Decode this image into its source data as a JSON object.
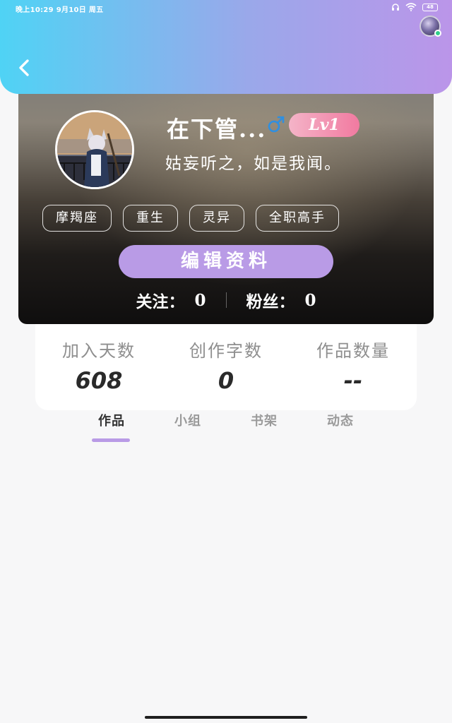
{
  "status_bar": {
    "time": "晚上10:29  9月10日  周五",
    "battery": "48"
  },
  "profile": {
    "username": "在下管...",
    "gender_symbol": "♂",
    "level": "Lv1",
    "bio": "姑妄听之，如是我闻。",
    "tags": [
      "摩羯座",
      "重生",
      "灵异",
      "全职高手"
    ],
    "edit_label": "编辑资料",
    "following_label": "关注：",
    "following_count": "0",
    "followers_label": "粉丝：",
    "followers_count": "0"
  },
  "stats": [
    {
      "label": "加入天数",
      "value": "608"
    },
    {
      "label": "创作字数",
      "value": "0"
    },
    {
      "label": "作品数量",
      "value": "--"
    }
  ],
  "tabs": [
    "作品",
    "小组",
    "书架",
    "动态"
  ],
  "active_tab": "作品",
  "colors": {
    "accent": "#b99be6",
    "header_start": "#4fd3f5",
    "header_end": "#bb95e9",
    "level_badge": "#f17aa0"
  }
}
